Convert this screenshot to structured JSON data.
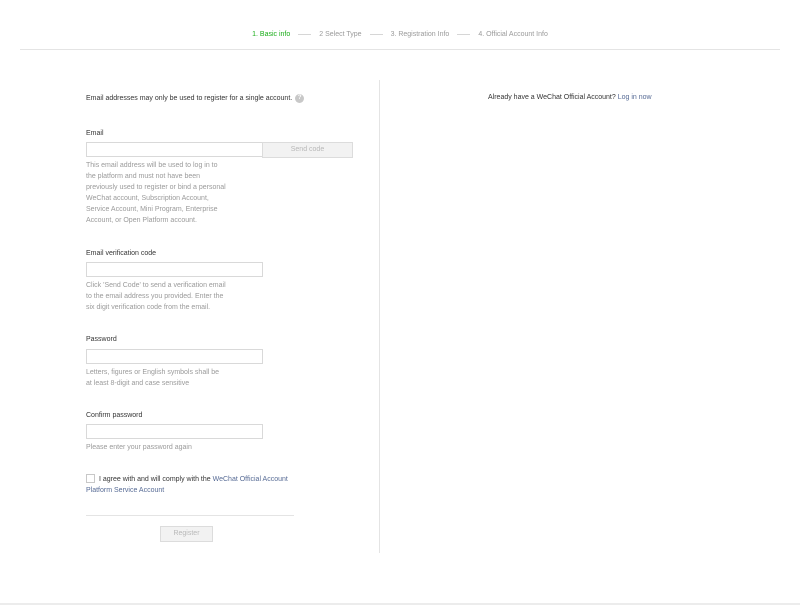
{
  "steps": [
    {
      "label": "1. Basic info",
      "active": true
    },
    {
      "label": "2 Select Type",
      "active": false
    },
    {
      "label": "3. Registration Info",
      "active": false
    },
    {
      "label": "4. Official Account Info",
      "active": false
    }
  ],
  "form": {
    "intro": "Email addresses may only be used to register for a single account.",
    "help_icon": "question-circle-icon",
    "email": {
      "label": "Email",
      "value": "",
      "send_code": "Send code",
      "hint": [
        "This email address will be used to log in to",
        "the platform and must not have been",
        "previously used to register or bind a personal",
        "WeChat account, Subscription Account,",
        "Service Account, Mini Program, Enterprise",
        "Account, or Open Platform account."
      ]
    },
    "verification": {
      "label": "Email verification code",
      "value": "",
      "hint": [
        "Click 'Send Code' to send a verification email",
        "to the email address you provided. Enter the",
        "six digit verification code from the email."
      ]
    },
    "password": {
      "label": "Password",
      "value": "",
      "hint": [
        "Letters, figures or English symbols shall be",
        "at least 8-digit and case sensitive"
      ]
    },
    "confirm_password": {
      "label": "Confirm password",
      "value": "",
      "hint": "Please enter your password again"
    },
    "agreement": {
      "checked": false,
      "text": "I agree with and will comply with the",
      "link_line1": "WeChat Official Account",
      "link_line2": "Platform Service Account"
    },
    "register": "Register"
  },
  "aside": {
    "text": "Already have a WeChat Official Account?",
    "link": "Log in now"
  },
  "colors": {
    "active_step": "#1aad19",
    "link": "#576b95"
  }
}
